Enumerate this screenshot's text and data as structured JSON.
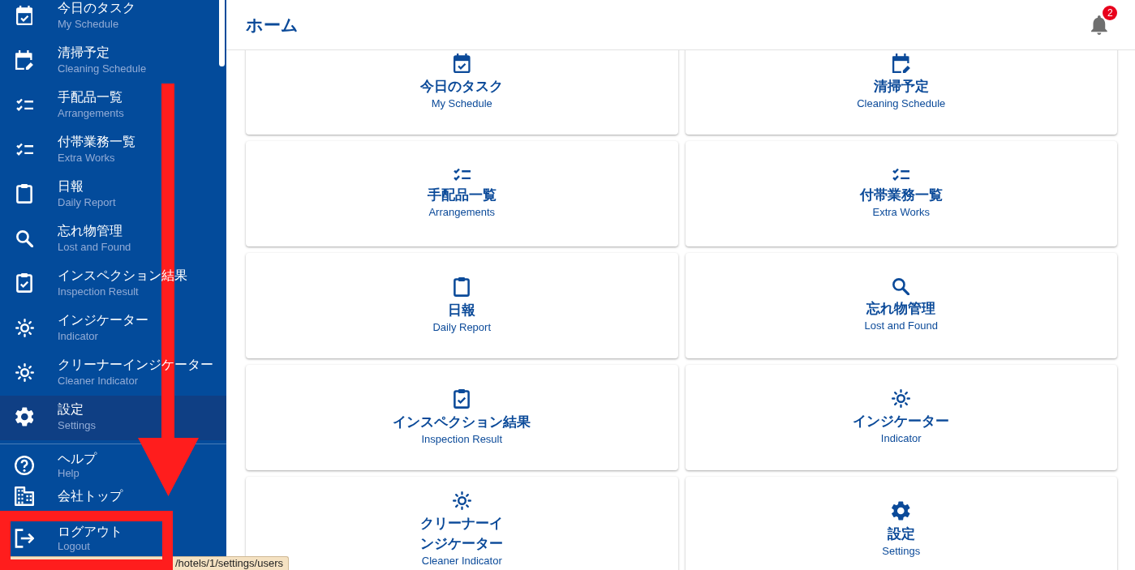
{
  "sidebar": {
    "items": [
      {
        "kind": "calendar",
        "title": "今日のタスク",
        "subtitle": "My Schedule",
        "hovered": false
      },
      {
        "kind": "planner",
        "title": "清掃予定",
        "subtitle": "Cleaning Schedule",
        "hovered": false
      },
      {
        "kind": "checklist",
        "title": "手配品一覧",
        "subtitle": "Arrangements",
        "hovered": false
      },
      {
        "kind": "checklist",
        "title": "付帯業務一覧",
        "subtitle": "Extra Works",
        "hovered": false
      },
      {
        "kind": "clipboard",
        "title": "日報",
        "subtitle": "Daily Report",
        "hovered": false
      },
      {
        "kind": "search",
        "title": "忘れ物管理",
        "subtitle": "Lost and Found",
        "hovered": false
      },
      {
        "kind": "inspection",
        "title": "インスペクション結果",
        "subtitle": "Inspection Result",
        "hovered": false
      },
      {
        "kind": "sun",
        "title": "インジケーター",
        "subtitle": "Indicator",
        "hovered": false
      },
      {
        "kind": "sun",
        "title": "クリーナーインジケーター",
        "subtitle": "Cleaner Indicator",
        "hovered": false
      },
      {
        "kind": "gear",
        "title": "設定",
        "subtitle": "Settings",
        "hovered": true
      }
    ],
    "footer_items": [
      {
        "kind": "help",
        "title": "ヘルプ",
        "subtitle": "Help"
      },
      {
        "kind": "building",
        "title": "会社トップ"
      },
      {
        "kind": "exit",
        "title": "ログアウト",
        "subtitle": "Logout"
      }
    ]
  },
  "header": {
    "title": "ホーム",
    "notification_count": "2"
  },
  "cards": [
    {
      "kind": "calendar",
      "title": "今日のタスク",
      "subtitle": "My Schedule"
    },
    {
      "kind": "planner",
      "title": "清掃予定",
      "subtitle": "Cleaning Schedule"
    },
    {
      "kind": "checklist",
      "title": "手配品一覧",
      "subtitle": "Arrangements"
    },
    {
      "kind": "checklist",
      "title": "付帯業務一覧",
      "subtitle": "Extra Works"
    },
    {
      "kind": "clipboard",
      "title": "日報",
      "subtitle": "Daily Report"
    },
    {
      "kind": "search",
      "title": "忘れ物管理",
      "subtitle": "Lost and Found"
    },
    {
      "kind": "inspection",
      "title": "インスペクション結果",
      "subtitle": "Inspection Result"
    },
    {
      "kind": "sun",
      "title": "インジケーター",
      "subtitle": "Indicator"
    },
    {
      "kind": "sun",
      "title": "クリーナーインジケーター",
      "subtitle": "Cleaner Indicator"
    },
    {
      "kind": "gear",
      "title": "設定",
      "subtitle": "Settings"
    }
  ],
  "status_bar": {
    "url": "/hotels/1/settings/users"
  },
  "annotations": {
    "arrow": true,
    "highlight_frame": true
  }
}
